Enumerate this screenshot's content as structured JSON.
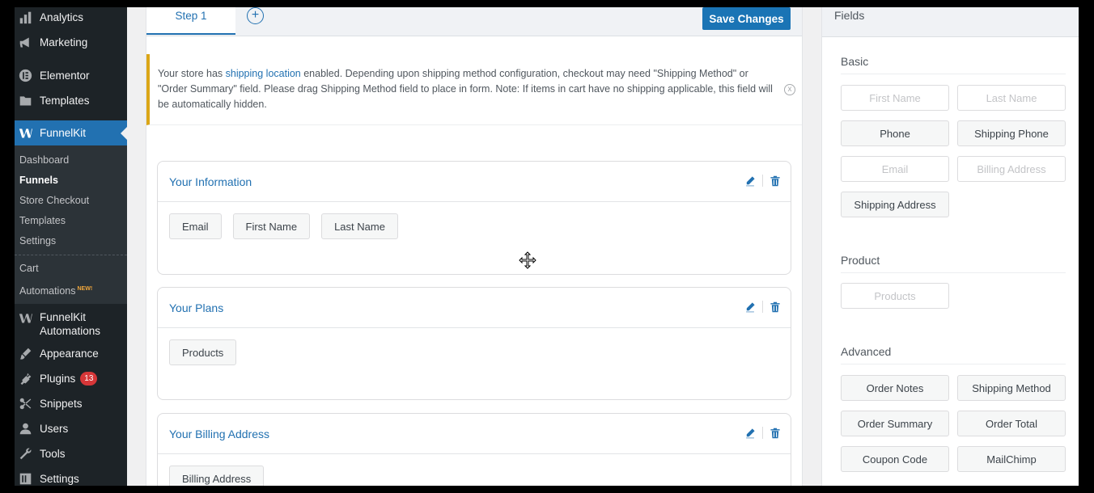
{
  "sidebar": {
    "top_items": [
      {
        "label": "Analytics",
        "icon": "bar-chart-icon"
      },
      {
        "label": "Marketing",
        "icon": "megaphone-icon"
      },
      {
        "label": "Elementor",
        "icon": "elementor-icon"
      },
      {
        "label": "Templates",
        "icon": "folder-icon"
      }
    ],
    "active_item": {
      "label": "FunnelKit",
      "icon": "funnelkit-icon"
    },
    "submenu": [
      "Dashboard",
      "Funnels",
      "Store Checkout",
      "Templates",
      "Settings"
    ],
    "submenu_current": "Funnels",
    "submenu_extra": [
      {
        "label": "Cart",
        "tag": ""
      },
      {
        "label": "Automations",
        "tag": "NEW!"
      }
    ],
    "bottom_items": [
      {
        "label": "FunnelKit Automations",
        "icon": "funnelkit-icon"
      },
      {
        "label": "Appearance",
        "icon": "paintbrush-icon"
      },
      {
        "label": "Plugins",
        "icon": "plugin-icon",
        "badge": "13"
      },
      {
        "label": "Snippets",
        "icon": "scissors-icon"
      },
      {
        "label": "Users",
        "icon": "user-icon"
      },
      {
        "label": "Tools",
        "icon": "wrench-icon"
      },
      {
        "label": "Settings",
        "icon": "settings-icon"
      }
    ]
  },
  "editor": {
    "tab_label": "Step 1",
    "add_tab": "+",
    "save_label": "Save Changes",
    "notice": {
      "before_link": "Your store has ",
      "link": "shipping location",
      "after_link": " enabled. Depending upon shipping method configuration, checkout may need \"Shipping Method\" or \"Order Summary\" field. Please drag Shipping Method field to place in form. Note: If items in cart have no shipping applicable, this field will be automatically hidden.",
      "close": "x"
    },
    "sections": [
      {
        "title": "Your Information",
        "fields": [
          "Email",
          "First Name",
          "Last Name"
        ]
      },
      {
        "title": "Your Plans",
        "fields": [
          "Products"
        ]
      },
      {
        "title": "Your Billing Address",
        "fields": [
          "Billing Address"
        ]
      }
    ]
  },
  "fields_panel": {
    "title": "Fields",
    "groups": {
      "basic": {
        "title": "Basic",
        "items": [
          {
            "label": "First Name",
            "disabled": true
          },
          {
            "label": "Last Name",
            "disabled": true
          },
          {
            "label": "Phone",
            "disabled": false
          },
          {
            "label": "Shipping Phone",
            "disabled": false
          },
          {
            "label": "Email",
            "disabled": true
          },
          {
            "label": "Billing Address",
            "disabled": true
          },
          {
            "label": "Shipping Address",
            "disabled": false
          }
        ]
      },
      "product": {
        "title": "Product",
        "items": [
          {
            "label": "Products",
            "disabled": true
          }
        ]
      },
      "advanced": {
        "title": "Advanced",
        "items": [
          {
            "label": "Order Notes",
            "disabled": false
          },
          {
            "label": "Shipping Method",
            "disabled": false
          },
          {
            "label": "Order Summary",
            "disabled": false
          },
          {
            "label": "Order Total",
            "disabled": false
          },
          {
            "label": "Coupon Code",
            "disabled": false
          },
          {
            "label": "MailChimp",
            "disabled": false
          }
        ]
      }
    }
  },
  "colors": {
    "accent": "#2271b1",
    "notice_border": "#dba617",
    "sidebar_bg": "#1d2327",
    "badge": "#d63638"
  }
}
